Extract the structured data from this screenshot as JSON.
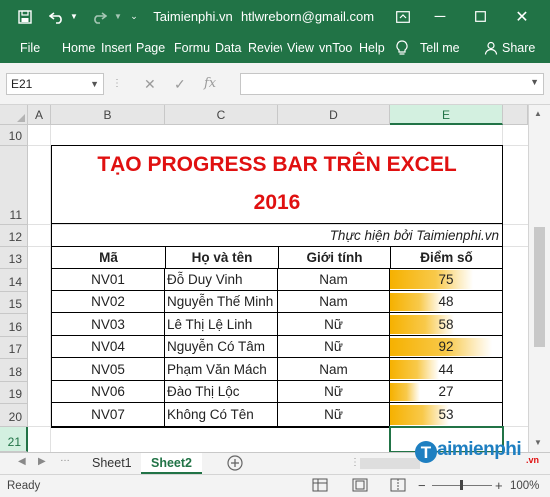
{
  "titlebar": {
    "website": "Taimienphi.vn",
    "email": "htlwreborn@gmail.com"
  },
  "ribbon": {
    "tabs": [
      "File",
      "Home",
      "Insert",
      "Page L",
      "Formu",
      "Data",
      "Review",
      "View",
      "vnToo",
      "Help"
    ],
    "tell_me": "Tell me",
    "share": "Share"
  },
  "formula_bar": {
    "name_box": "E21",
    "fx": "fx",
    "value": ""
  },
  "columns": [
    "A",
    "B",
    "C",
    "D",
    "E"
  ],
  "rows": [
    "10",
    "11",
    "12",
    "13",
    "14",
    "15",
    "16",
    "17",
    "18",
    "19",
    "20",
    "21"
  ],
  "sheet": {
    "title_line1": "TẠO PROGRESS BAR TRÊN EXCEL",
    "title_line2": "2016",
    "author": "Thực hiện bởi Taimienphi.vn",
    "headers": [
      "Mã",
      "Họ và tên",
      "Giới tính",
      "Điểm số"
    ],
    "records": [
      {
        "code": "NV01",
        "name": "Đỗ Duy Vinh",
        "gender": "Nam",
        "score": "75",
        "fill": 0.75
      },
      {
        "code": "NV02",
        "name": "Nguyễn Thế Minh",
        "gender": "Nam",
        "score": "48",
        "fill": 0.48
      },
      {
        "code": "NV03",
        "name": "Lê Thị Lệ Linh",
        "gender": "Nữ",
        "score": "58",
        "fill": 0.58
      },
      {
        "code": "NV04",
        "name": "Nguyễn Có Tâm",
        "gender": "Nữ",
        "score": "92",
        "fill": 0.92
      },
      {
        "code": "NV05",
        "name": "Phạm Văn Mách",
        "gender": "Nam",
        "score": "44",
        "fill": 0.44
      },
      {
        "code": "NV06",
        "name": "Đào Thị Lộc",
        "gender": "Nữ",
        "score": "27",
        "fill": 0.27
      },
      {
        "code": "NV07",
        "name": "Không Có Tên",
        "gender": "Nữ",
        "score": "53",
        "fill": 0.53
      }
    ]
  },
  "tabs": {
    "sheet1": "Sheet1",
    "sheet2": "Sheet2"
  },
  "status": {
    "ready": "Ready",
    "zoom": "100%"
  },
  "logo": {
    "text": "aimienphi",
    "suffix": ".vn"
  },
  "colors": {
    "excel_green": "#217346",
    "title_red": "#e01010",
    "bar_orange": "#f6b100"
  }
}
